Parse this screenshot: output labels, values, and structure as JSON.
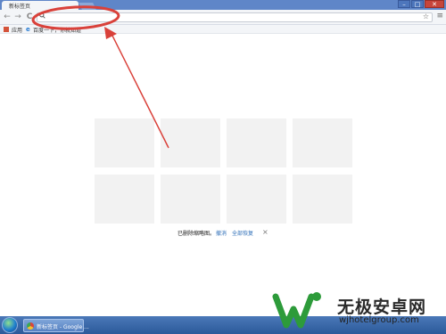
{
  "browser": {
    "tab_title": "新标签页",
    "window_controls": [
      "–",
      "□",
      "✕"
    ]
  },
  "toolbar": {
    "back_icon": "←",
    "forward_icon": "→",
    "reload_icon": "C",
    "search_icon": "🔍",
    "omnibox_value": "",
    "star_icon": "☆",
    "menu_icon": "≡"
  },
  "bookmarks": {
    "apps_label": "应用",
    "item_label": "百度一下，你就知道"
  },
  "new_tab": {
    "restore_text": "已删除缩略图。",
    "undo_label": "撤消",
    "restore_all_label": "全部恢复",
    "close_icon": "×"
  },
  "taskbar": {
    "task_label": "新标签页 - Google ..."
  },
  "watermark": {
    "title": "无极安卓网",
    "url": "wjhotelgroup.com"
  },
  "colors": {
    "annotation": "#d9413a",
    "link": "#2f6fb8",
    "tab_strip": "#5f86c8",
    "tile": "#f2f2f2"
  }
}
